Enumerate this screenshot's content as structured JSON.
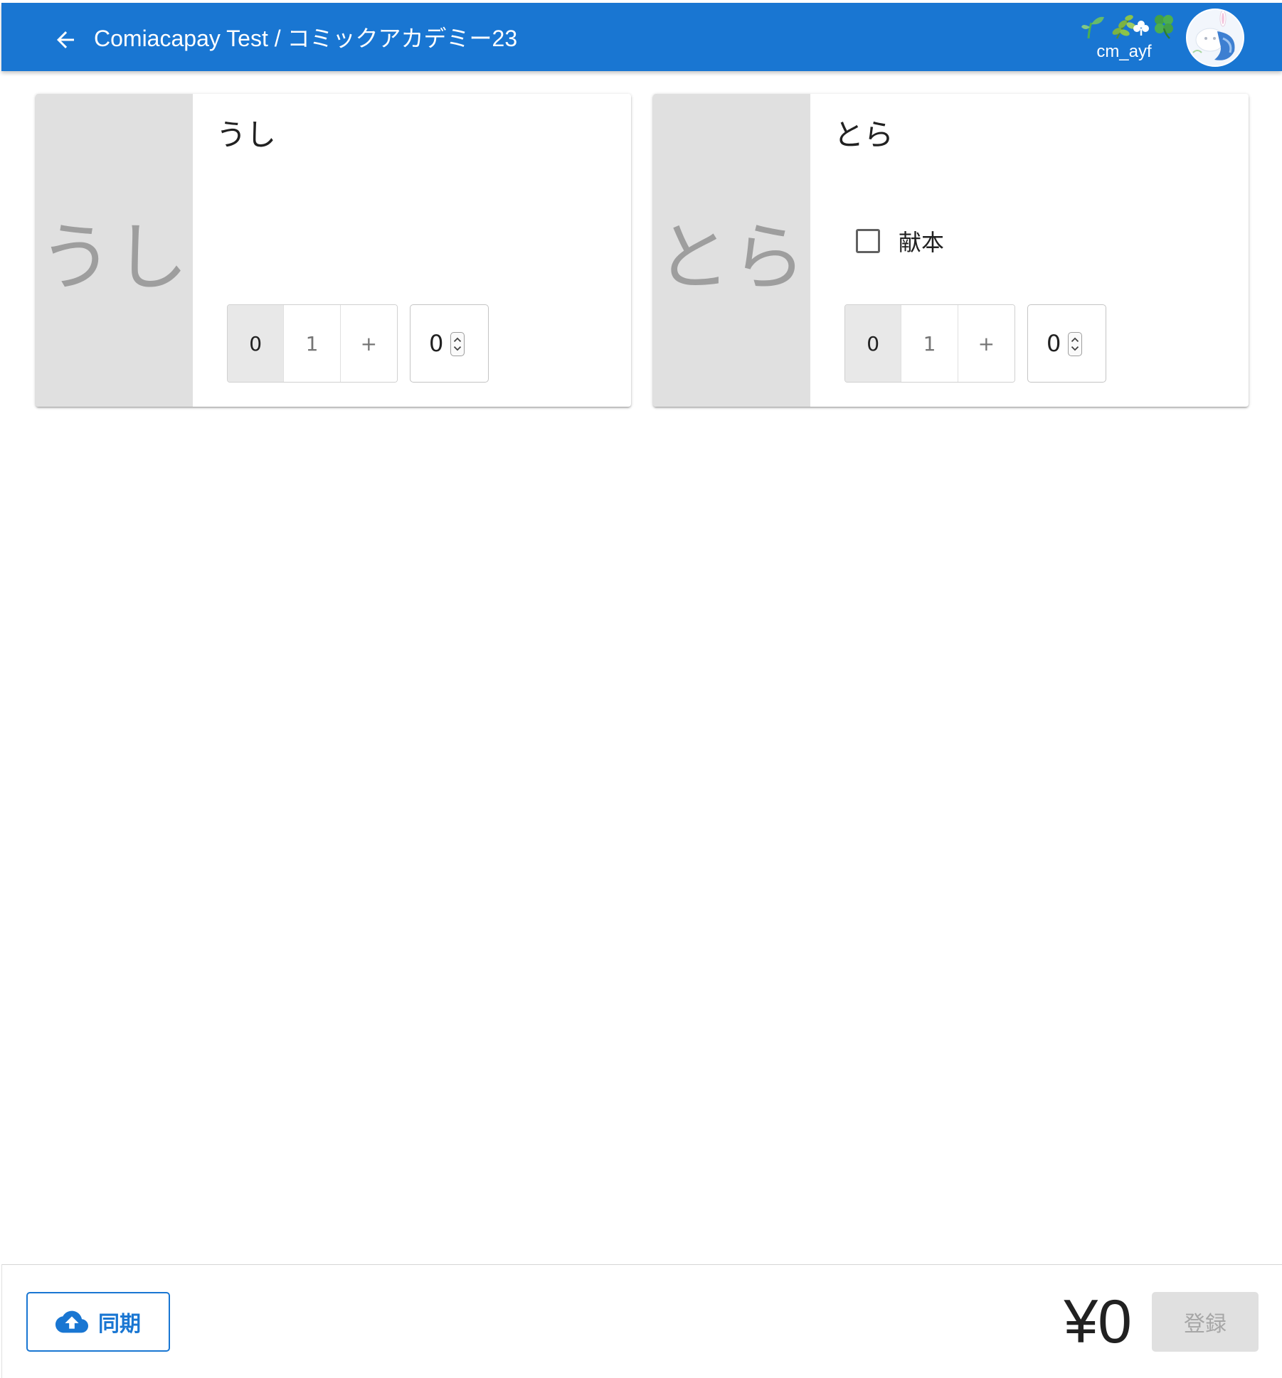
{
  "appbar": {
    "back_icon": "arrow-left-icon",
    "title": "Comiacapay Test / コミックアカデミー23",
    "background_color": "#1976d2",
    "user": {
      "name": "cm_ayf",
      "badge_icons": [
        "seedling-icon",
        "herb-icon",
        "shamrock-icon",
        "four-leaf-clover-icon"
      ]
    }
  },
  "products": [
    {
      "thumbnail_text": "うし",
      "name": "うし",
      "has_dedication_option": false,
      "quantity_buttons": [
        "0",
        "1",
        "+"
      ],
      "selected_quantity_button": "0",
      "quantity_value": "0"
    },
    {
      "thumbnail_text": "とら",
      "name": "とら",
      "has_dedication_option": true,
      "dedication_label": "献本",
      "dedication_checked": false,
      "quantity_buttons": [
        "0",
        "1",
        "+"
      ],
      "selected_quantity_button": "0",
      "quantity_value": "0"
    }
  ],
  "footer": {
    "sync_icon": "cloud-upload-icon",
    "sync_label": "同期",
    "total": "¥0",
    "register_label": "登録",
    "register_enabled": false,
    "accent_color": "#1976d2"
  }
}
